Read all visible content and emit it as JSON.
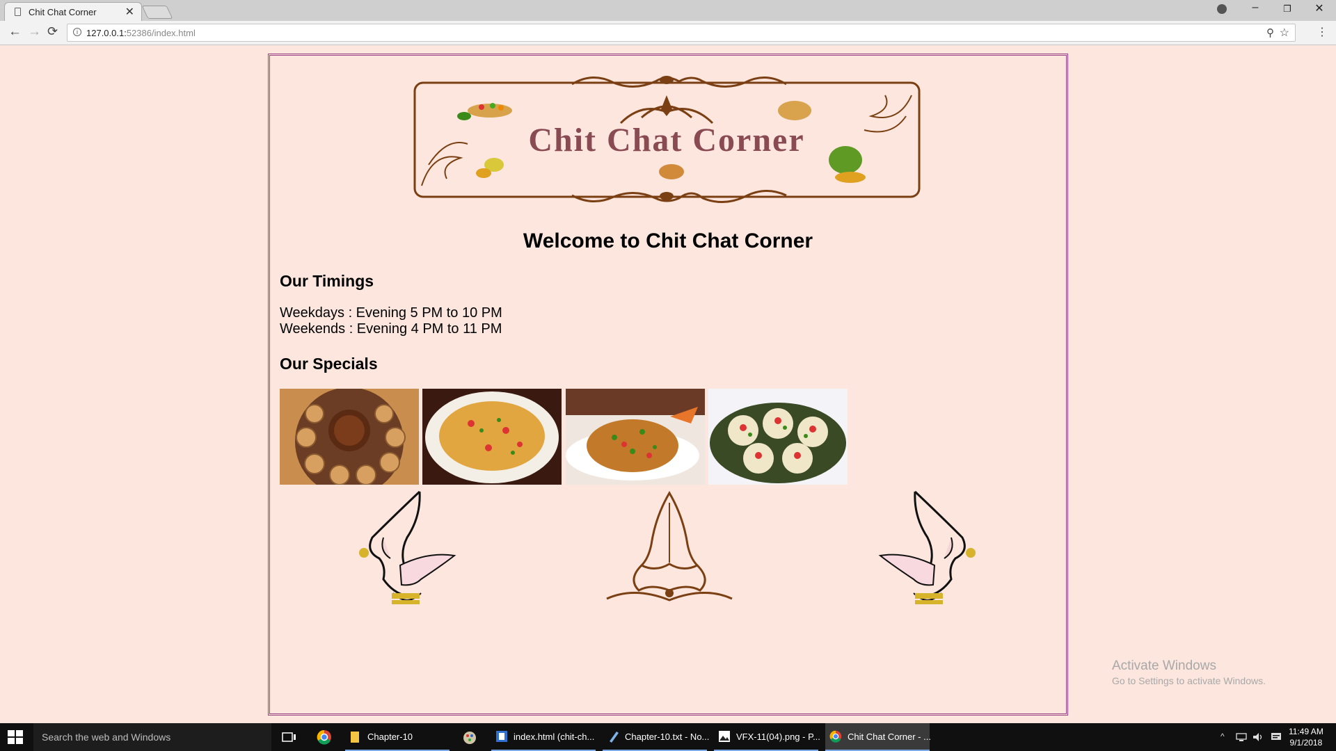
{
  "browser": {
    "tab_title": "Chit Chat Corner",
    "tab_close": "✕",
    "url_host": "127.0.0.1:",
    "url_port_path": "52386/index.html",
    "window_controls": {
      "minimize": "–",
      "restore": "❐",
      "close": "✕"
    },
    "nav": {
      "back": "←",
      "forward": "→",
      "reload": "⟳"
    },
    "zoom_icon": "⚲",
    "bookmark_icon": "☆",
    "menu_icon": "⋮"
  },
  "page": {
    "banner_text": "Chit Chat Corner",
    "welcome": "Welcome to Chit Chat Corner",
    "timings_heading": "Our Timings",
    "timings": [
      "Weekdays : Evening 5 PM to 10 PM",
      "Weekends : Evening 4 PM to 11 PM"
    ],
    "specials_heading": "Our Specials",
    "specials": [
      {
        "name": "pani-puri-image"
      },
      {
        "name": "sev-puri-image"
      },
      {
        "name": "bhel-puri-image"
      },
      {
        "name": "dahi-puri-image"
      }
    ]
  },
  "watermark": {
    "line1": "Activate Windows",
    "line2": "Go to Settings to activate Windows."
  },
  "taskbar": {
    "search_placeholder": "Search the web and Windows",
    "items": [
      {
        "label": "Chapter-10"
      },
      {
        "label": "index.html (chit-ch..."
      },
      {
        "label": "Chapter-10.txt - No..."
      },
      {
        "label": "VFX-11(04).png - P..."
      },
      {
        "label": "Chit Chat Corner - ..."
      }
    ],
    "time": "11:49 AM",
    "date": "9/1/2018",
    "tray_icons": [
      "chevron-up-icon",
      "network-icon",
      "volume-icon",
      "notification-icon"
    ]
  },
  "colors": {
    "page_background": "#fde6de",
    "frame_border": "#9b3f84",
    "banner_brown": "#7a3f12",
    "banner_title": "#8a4a52"
  }
}
